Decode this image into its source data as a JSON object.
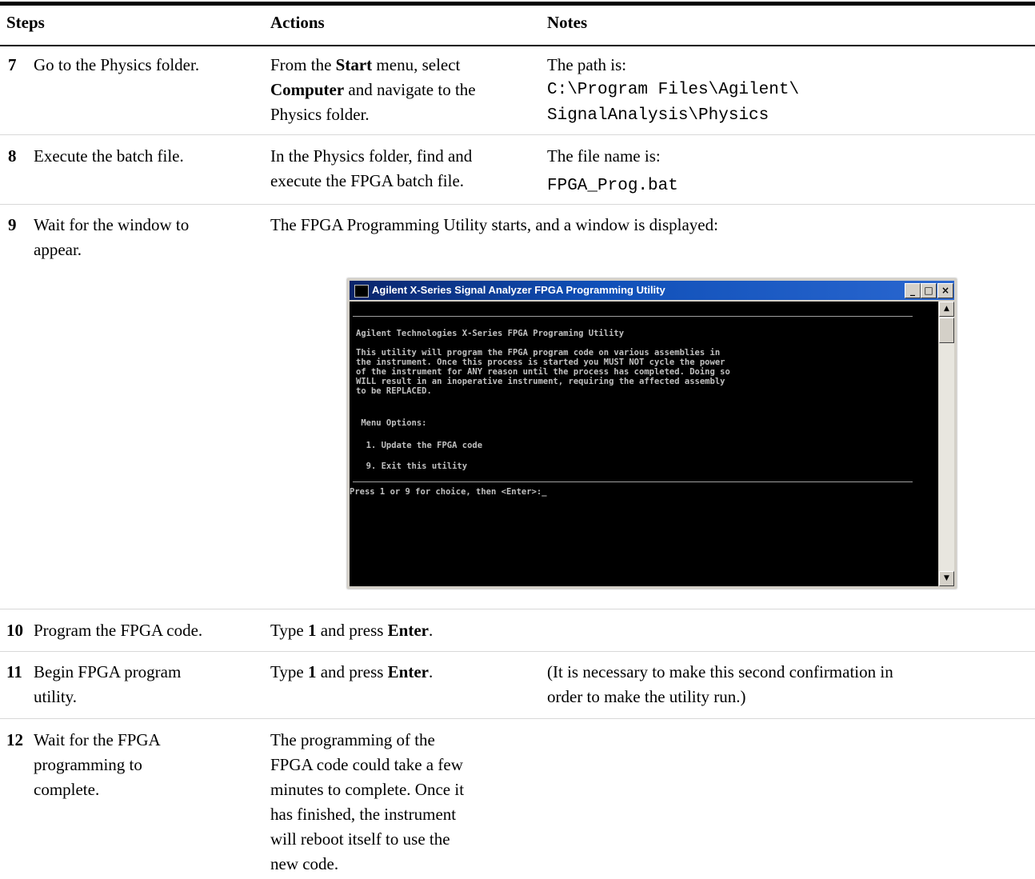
{
  "headers": {
    "steps": "Steps",
    "actions": "Actions",
    "notes": "Notes"
  },
  "rows": [
    {
      "num": "7",
      "step": "Go to the Physics folder.",
      "action_pre": "From the ",
      "action_b1": "Start",
      "action_mid": " menu, select",
      "action_b2": "Computer",
      "action_post": " and navigate to the",
      "action_line3": "Physics folder.",
      "note_line1": "The path is:",
      "note_mono1": "C:\\Program Files\\Agilent\\",
      "note_mono2": "SignalAnalysis\\Physics"
    },
    {
      "num": "8",
      "step": "Execute the batch file.",
      "action_line1": "In the Physics folder, find and",
      "action_line2": "execute the FPGA batch file.",
      "note_line1": "The file name is:",
      "note_mono1": "FPGA_Prog.bat"
    },
    {
      "num": "9",
      "step_line1": "Wait for the window to",
      "step_line2": "appear.",
      "action": "The FPGA Programming Utility starts, and a window is displayed:"
    },
    {
      "num": "10",
      "step": "Program the FPGA code.",
      "action_pre": "Type ",
      "action_b1": "1",
      "action_mid": " and press ",
      "action_b2": "Enter",
      "action_post": "."
    },
    {
      "num": "11",
      "step_line1": "Begin FPGA program",
      "step_line2": "utility.",
      "action_pre": "Type ",
      "action_b1": "1",
      "action_mid": " and press ",
      "action_b2": "Enter",
      "action_post": ".",
      "note_line1": "(It is necessary to make this second confirmation in",
      "note_line2": "order to make the utility run.)"
    },
    {
      "num": "12",
      "step_lines": [
        "Wait for the FPGA",
        "programming to",
        "complete."
      ],
      "action_lines": [
        "The programming of the",
        "FPGA code could take a few",
        "minutes to complete. Once it",
        "has finished, the instrument",
        "will reboot itself to use the",
        "new code."
      ]
    }
  ],
  "console_window": {
    "title": "Agilent X-Series Signal Analyzer FPGA Programming Utility",
    "buttons": [
      "_",
      "□",
      "×"
    ],
    "lines": [
      "Agilent Technologies X-Series FPGA Programing Utility",
      "This utility will program the FPGA program code on various assemblies in",
      "the instrument. Once this process is started you MUST NOT cycle the power",
      "of the instrument for ANY reason until the process has completed. Doing so",
      "WILL result in an inoperative instrument, requiring the affected assembly",
      "to be REPLACED.",
      " Menu Options:",
      "  1. Update the FPGA code",
      "  9. Exit this utility",
      "Press 1 or 9 for choice, then <Enter>:_"
    ]
  }
}
